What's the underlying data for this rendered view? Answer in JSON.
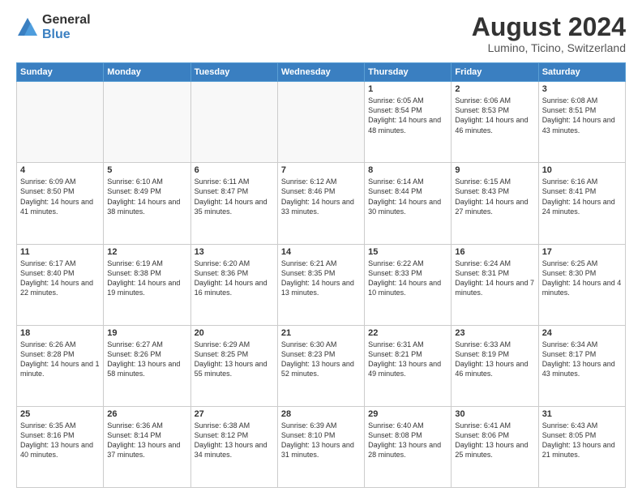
{
  "header": {
    "logo_general": "General",
    "logo_blue": "Blue",
    "month_year": "August 2024",
    "location": "Lumino, Ticino, Switzerland"
  },
  "days_of_week": [
    "Sunday",
    "Monday",
    "Tuesday",
    "Wednesday",
    "Thursday",
    "Friday",
    "Saturday"
  ],
  "weeks": [
    [
      {
        "day": "",
        "info": ""
      },
      {
        "day": "",
        "info": ""
      },
      {
        "day": "",
        "info": ""
      },
      {
        "day": "",
        "info": ""
      },
      {
        "day": "1",
        "info": "Sunrise: 6:05 AM\nSunset: 8:54 PM\nDaylight: 14 hours\nand 48 minutes."
      },
      {
        "day": "2",
        "info": "Sunrise: 6:06 AM\nSunset: 8:53 PM\nDaylight: 14 hours\nand 46 minutes."
      },
      {
        "day": "3",
        "info": "Sunrise: 6:08 AM\nSunset: 8:51 PM\nDaylight: 14 hours\nand 43 minutes."
      }
    ],
    [
      {
        "day": "4",
        "info": "Sunrise: 6:09 AM\nSunset: 8:50 PM\nDaylight: 14 hours\nand 41 minutes."
      },
      {
        "day": "5",
        "info": "Sunrise: 6:10 AM\nSunset: 8:49 PM\nDaylight: 14 hours\nand 38 minutes."
      },
      {
        "day": "6",
        "info": "Sunrise: 6:11 AM\nSunset: 8:47 PM\nDaylight: 14 hours\nand 35 minutes."
      },
      {
        "day": "7",
        "info": "Sunrise: 6:12 AM\nSunset: 8:46 PM\nDaylight: 14 hours\nand 33 minutes."
      },
      {
        "day": "8",
        "info": "Sunrise: 6:14 AM\nSunset: 8:44 PM\nDaylight: 14 hours\nand 30 minutes."
      },
      {
        "day": "9",
        "info": "Sunrise: 6:15 AM\nSunset: 8:43 PM\nDaylight: 14 hours\nand 27 minutes."
      },
      {
        "day": "10",
        "info": "Sunrise: 6:16 AM\nSunset: 8:41 PM\nDaylight: 14 hours\nand 24 minutes."
      }
    ],
    [
      {
        "day": "11",
        "info": "Sunrise: 6:17 AM\nSunset: 8:40 PM\nDaylight: 14 hours\nand 22 minutes."
      },
      {
        "day": "12",
        "info": "Sunrise: 6:19 AM\nSunset: 8:38 PM\nDaylight: 14 hours\nand 19 minutes."
      },
      {
        "day": "13",
        "info": "Sunrise: 6:20 AM\nSunset: 8:36 PM\nDaylight: 14 hours\nand 16 minutes."
      },
      {
        "day": "14",
        "info": "Sunrise: 6:21 AM\nSunset: 8:35 PM\nDaylight: 14 hours\nand 13 minutes."
      },
      {
        "day": "15",
        "info": "Sunrise: 6:22 AM\nSunset: 8:33 PM\nDaylight: 14 hours\nand 10 minutes."
      },
      {
        "day": "16",
        "info": "Sunrise: 6:24 AM\nSunset: 8:31 PM\nDaylight: 14 hours\nand 7 minutes."
      },
      {
        "day": "17",
        "info": "Sunrise: 6:25 AM\nSunset: 8:30 PM\nDaylight: 14 hours\nand 4 minutes."
      }
    ],
    [
      {
        "day": "18",
        "info": "Sunrise: 6:26 AM\nSunset: 8:28 PM\nDaylight: 14 hours\nand 1 minute."
      },
      {
        "day": "19",
        "info": "Sunrise: 6:27 AM\nSunset: 8:26 PM\nDaylight: 13 hours\nand 58 minutes."
      },
      {
        "day": "20",
        "info": "Sunrise: 6:29 AM\nSunset: 8:25 PM\nDaylight: 13 hours\nand 55 minutes."
      },
      {
        "day": "21",
        "info": "Sunrise: 6:30 AM\nSunset: 8:23 PM\nDaylight: 13 hours\nand 52 minutes."
      },
      {
        "day": "22",
        "info": "Sunrise: 6:31 AM\nSunset: 8:21 PM\nDaylight: 13 hours\nand 49 minutes."
      },
      {
        "day": "23",
        "info": "Sunrise: 6:33 AM\nSunset: 8:19 PM\nDaylight: 13 hours\nand 46 minutes."
      },
      {
        "day": "24",
        "info": "Sunrise: 6:34 AM\nSunset: 8:17 PM\nDaylight: 13 hours\nand 43 minutes."
      }
    ],
    [
      {
        "day": "25",
        "info": "Sunrise: 6:35 AM\nSunset: 8:16 PM\nDaylight: 13 hours\nand 40 minutes."
      },
      {
        "day": "26",
        "info": "Sunrise: 6:36 AM\nSunset: 8:14 PM\nDaylight: 13 hours\nand 37 minutes."
      },
      {
        "day": "27",
        "info": "Sunrise: 6:38 AM\nSunset: 8:12 PM\nDaylight: 13 hours\nand 34 minutes."
      },
      {
        "day": "28",
        "info": "Sunrise: 6:39 AM\nSunset: 8:10 PM\nDaylight: 13 hours\nand 31 minutes."
      },
      {
        "day": "29",
        "info": "Sunrise: 6:40 AM\nSunset: 8:08 PM\nDaylight: 13 hours\nand 28 minutes."
      },
      {
        "day": "30",
        "info": "Sunrise: 6:41 AM\nSunset: 8:06 PM\nDaylight: 13 hours\nand 25 minutes."
      },
      {
        "day": "31",
        "info": "Sunrise: 6:43 AM\nSunset: 8:05 PM\nDaylight: 13 hours\nand 21 minutes."
      }
    ]
  ]
}
